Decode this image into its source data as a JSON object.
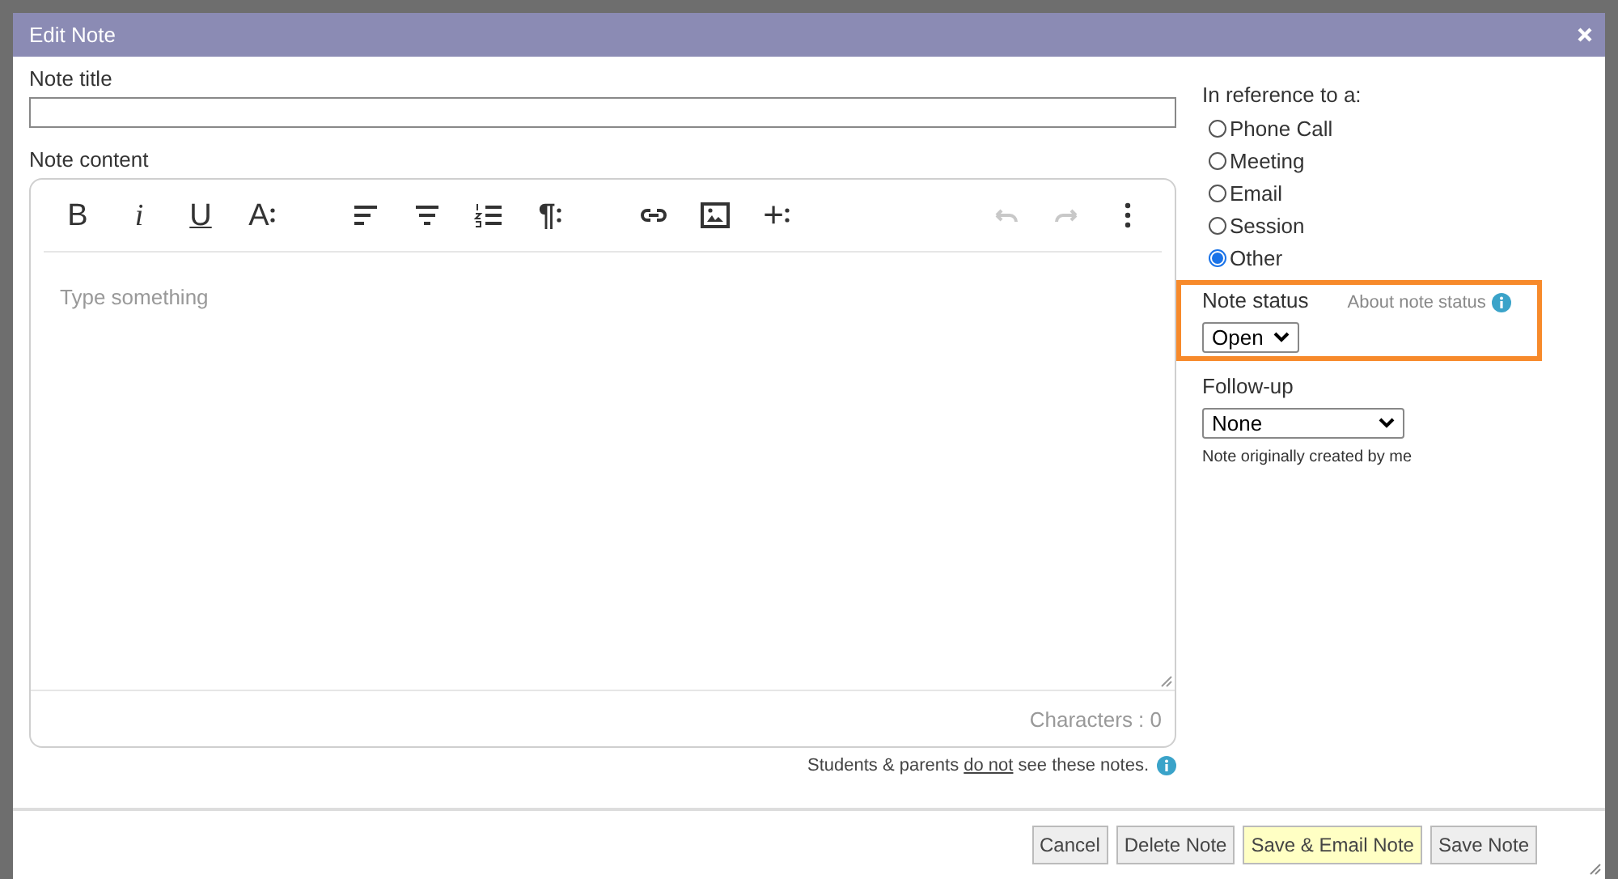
{
  "window": {
    "title": "Edit Note"
  },
  "note_title": {
    "label": "Note title"
  },
  "note_content": {
    "label": "Note content",
    "placeholder": "Type something",
    "character_count": "Characters : 0",
    "toolbar": [
      [
        {
          "kind": "bold",
          "label": "B",
          "disabled": false
        },
        {
          "kind": "italic",
          "label": "i",
          "disabled": false
        },
        {
          "kind": "underline",
          "label": "U",
          "disabled": false
        },
        {
          "kind": "font-size",
          "label": "A",
          "disabled": false
        }
      ],
      [
        {
          "kind": "align-left",
          "disabled": false
        },
        {
          "kind": "align-center",
          "disabled": false
        },
        {
          "kind": "ordered-list",
          "disabled": false
        },
        {
          "kind": "paragraph",
          "label": "¶",
          "disabled": false
        }
      ],
      [
        {
          "kind": "link",
          "disabled": false
        },
        {
          "kind": "image",
          "disabled": false
        },
        {
          "kind": "insert",
          "label": "+",
          "disabled": false
        }
      ],
      [
        {
          "kind": "undo",
          "disabled": true
        },
        {
          "kind": "redo",
          "disabled": true
        },
        {
          "kind": "more",
          "disabled": false
        }
      ]
    ]
  },
  "notice": {
    "before": "Students & parents ",
    "emphasis": "do not",
    "after": " see these notes."
  },
  "reference": {
    "label": "In reference to a:",
    "options": [
      {
        "label": "Phone Call",
        "selected": false
      },
      {
        "label": "Meeting",
        "selected": false
      },
      {
        "label": "Email",
        "selected": false
      },
      {
        "label": "Session",
        "selected": false
      },
      {
        "label": "Other",
        "selected": true
      }
    ]
  },
  "note_status": {
    "label": "Note status",
    "about_link": "About note status",
    "value": "Open",
    "highlighted": true
  },
  "follow_up": {
    "label": "Follow-up",
    "value": "None"
  },
  "created_by": "Note originally created by me",
  "buttons": [
    {
      "label": "Cancel",
      "kind": "default"
    },
    {
      "label": "Delete Note",
      "kind": "default"
    },
    {
      "label": "Save & Email Note",
      "kind": "highlight"
    },
    {
      "label": "Save Note",
      "kind": "default"
    }
  ]
}
